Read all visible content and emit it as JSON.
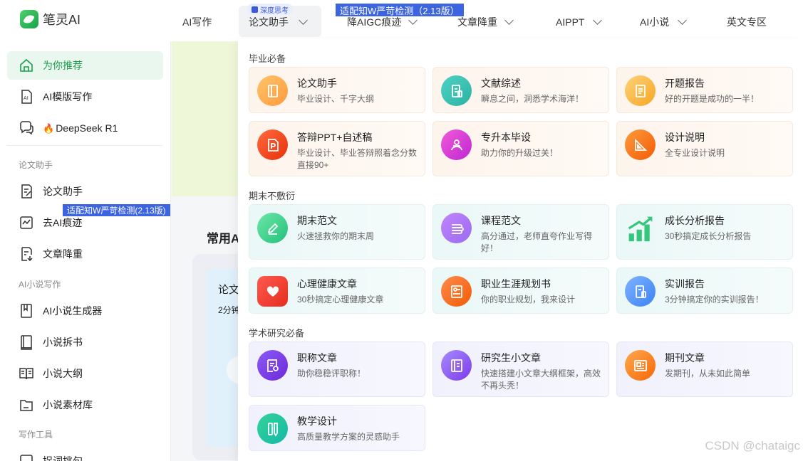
{
  "brand": {
    "name": "笔灵AI"
  },
  "nav": {
    "items": [
      {
        "label": "AI写作",
        "has_dropdown": false
      },
      {
        "label": "论文助手",
        "has_dropdown": true,
        "active": true
      },
      {
        "label": "降AIGC痕迹",
        "has_dropdown": true
      },
      {
        "label": "文章降重",
        "has_dropdown": true
      },
      {
        "label": "AIPPT",
        "has_dropdown": true
      },
      {
        "label": "AI小说",
        "has_dropdown": true
      },
      {
        "label": "英文专区",
        "has_dropdown": false
      }
    ],
    "deep_badge": "深度思考",
    "nav_tag": "适配知W严苛检测（2.13版）"
  },
  "sidebar": {
    "recommend": "为你推荐",
    "template": "AI模版写作",
    "deepseek": "DeepSeek R1",
    "section_paper": "论文助手",
    "paper": "论文助手",
    "tag": "适配知W严苛检测(2.13版)",
    "aigc": "去AI痕迹",
    "rewrite": "文章降重",
    "section_novel": "AI小说写作",
    "novel_gen": "AI小说生成器",
    "novel_split": "小说拆书",
    "novel_outline": "小说大纲",
    "novel_material": "小说素材库",
    "section_tools": "写作工具",
    "tools_item": "捉词挑句"
  },
  "main": {
    "title": "常用A",
    "card_title": "论文",
    "card_sub": "2分钟"
  },
  "dropdown": {
    "sections": [
      {
        "title": "毕业必备",
        "cards": [
          {
            "title": "论文助手",
            "desc": "毕业设计、千字大纲",
            "icon": "book-icon"
          },
          {
            "title": "文献综述",
            "desc": "瞬息之间，洞悉学术海洋！",
            "icon": "document-icon"
          },
          {
            "title": "开题报告",
            "desc": "好的开题是成功的一半！",
            "icon": "report-icon"
          },
          {
            "title": "答辩PPT+自述稿",
            "desc": "毕业设计、毕业答辩照着念分数直接90+",
            "icon": "ppt-icon"
          },
          {
            "title": "专升本毕设",
            "desc": "助力你的升级过关！",
            "icon": "student-icon"
          },
          {
            "title": "设计说明",
            "desc": "全专业设计说明",
            "icon": "ruler-icon"
          }
        ]
      },
      {
        "title": "期末不敷衍",
        "cards": [
          {
            "title": "期末范文",
            "desc": "火速拯救你的期末周",
            "icon": "pen-icon"
          },
          {
            "title": "课程范文",
            "desc": "高分通过，老师直夸作业写得好！",
            "icon": "notebook-icon"
          },
          {
            "title": "成长分析报告",
            "desc": "30秒搞定成长分析报告",
            "icon": "growth-chart-icon"
          },
          {
            "title": "心理健康文章",
            "desc": "30秒搞定心理健康文章",
            "icon": "heart-icon"
          },
          {
            "title": "职业生涯规划书",
            "desc": "你的职业规划，我来设计",
            "icon": "career-icon"
          },
          {
            "title": "实训报告",
            "desc": "3分钟搞定你的实训报告！",
            "icon": "training-report-icon"
          }
        ]
      },
      {
        "title": "学术研究必备",
        "cards": [
          {
            "title": "职称文章",
            "desc": "助你稳稳评职称！",
            "icon": "certificate-icon"
          },
          {
            "title": "研究生小文章",
            "desc": "快速搭建小文章大纲框架，高效不再头秃！",
            "icon": "article-icon"
          },
          {
            "title": "期刊文章",
            "desc": "发期刊，从未如此简单",
            "icon": "journal-icon"
          },
          {
            "title": "教学设计",
            "desc": "高质量教学方案的灵感助手",
            "icon": "teaching-icon"
          }
        ]
      }
    ]
  },
  "watermark": "CSDN @chataigc",
  "colors": {
    "accent": "#1a9e4b",
    "tag_blue": "#3c64e0"
  }
}
